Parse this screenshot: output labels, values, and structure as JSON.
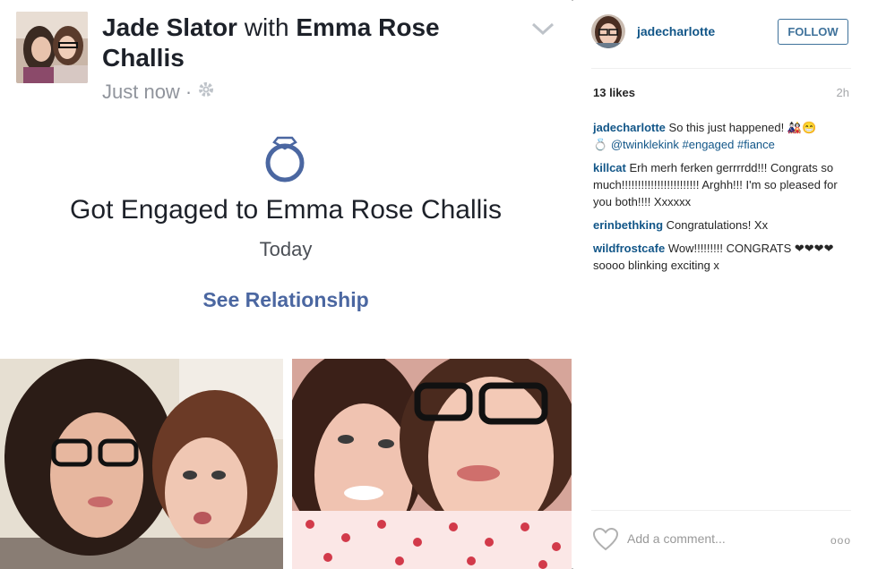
{
  "facebook": {
    "author": "Jade Slator",
    "with_word": "with",
    "tagged": "Emma Rose Challis",
    "time": "Just now",
    "separator": "·",
    "event_title": "Got Engaged to Emma Rose Challis",
    "event_date": "Today",
    "link_label": "See Relationship",
    "accent_color": "#4b67a1"
  },
  "instagram": {
    "username": "jadecharlotte",
    "follow_label": "FOLLOW",
    "likes": "13 likes",
    "time_ago": "2h",
    "comments": [
      {
        "user": "jadecharlotte",
        "text": "So this just happened! 🎎😁",
        "text2": "💍",
        "tags": [
          "@twinklekink",
          "#engaged",
          "#fiance"
        ]
      },
      {
        "user": "killcat",
        "text": "Erh merh ferken gerrrrdd!!! Congrats so much!!!!!!!!!!!!!!!!!!!!!!!! Arghh!!! I'm so pleased for you both!!!! Xxxxxx"
      },
      {
        "user": "erinbethking",
        "text": "Congratulations! Xx"
      },
      {
        "user": "wildfrostcafe",
        "text": "Wow!!!!!!!!! CONGRATS ❤❤❤❤ soooo blinking exciting x"
      }
    ],
    "comment_placeholder": "Add a comment...",
    "more_label": "ooo",
    "link_color": "#125688"
  }
}
